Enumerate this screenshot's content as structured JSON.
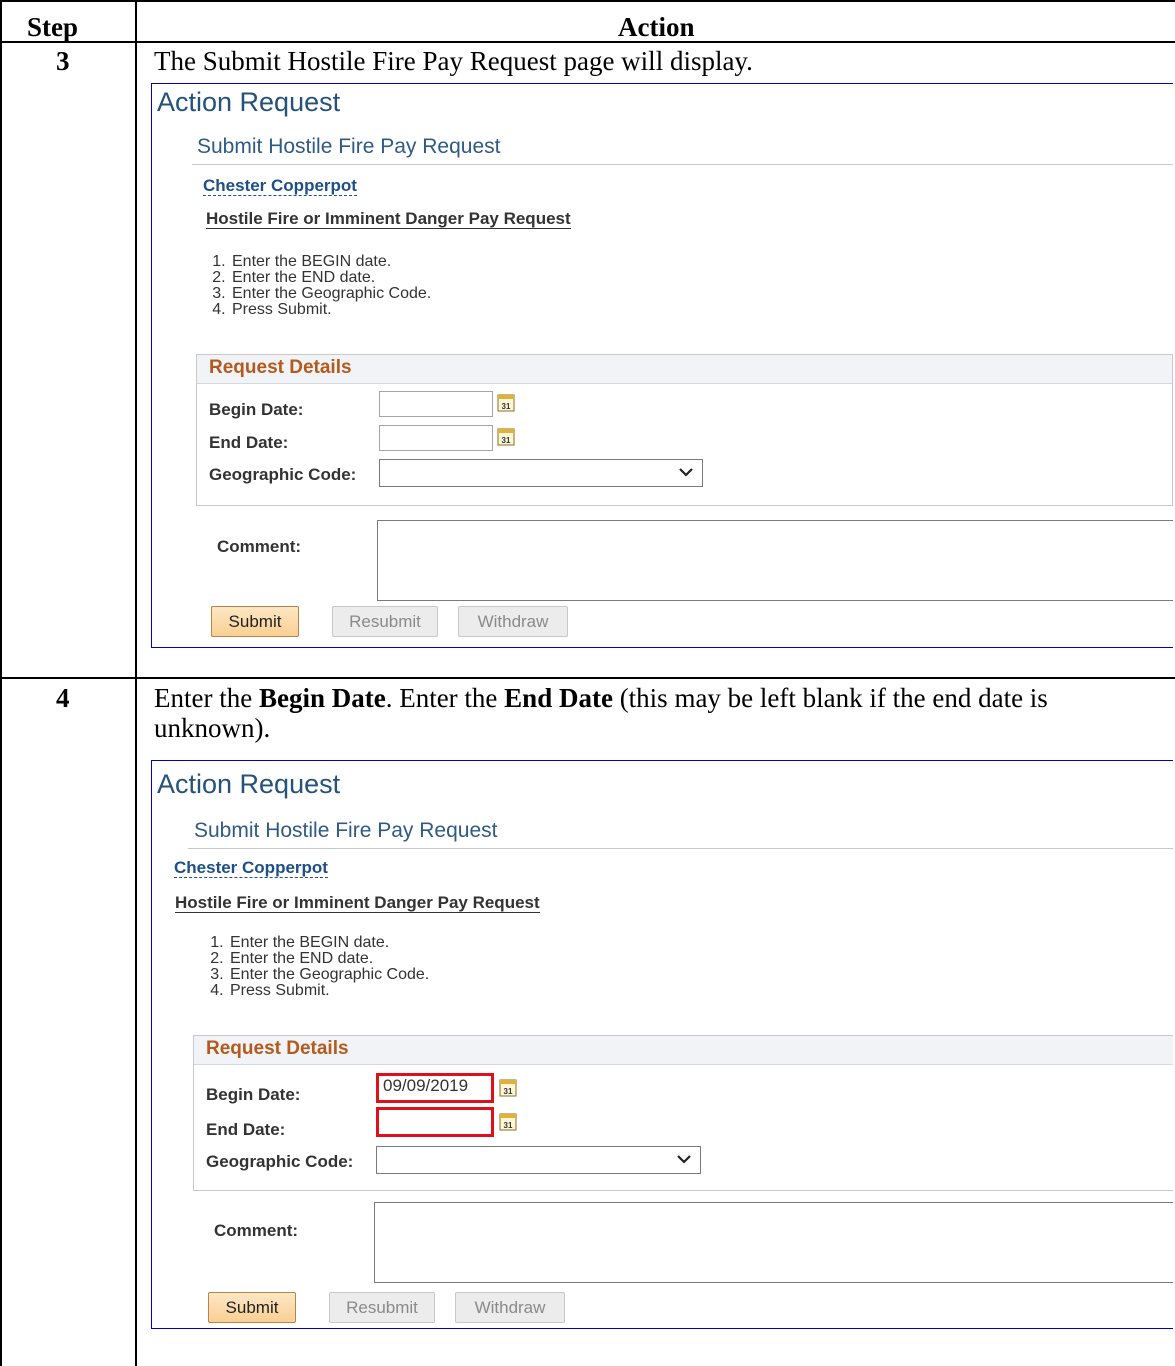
{
  "table": {
    "col_step": "Step",
    "col_action": "Action"
  },
  "steps": [
    {
      "number": "3",
      "instruction": "The Submit Hostile Fire Pay Request page will display.",
      "screen": {
        "title": "Action Request",
        "subtitle": "Submit Hostile Fire Pay Request",
        "person": "Chester Copperpot",
        "page_title": "Hostile Fire or Imminent Danger Pay Request",
        "list": [
          "Enter the BEGIN date.",
          "Enter the END date.",
          "Enter the Geographic Code.",
          "Press Submit."
        ],
        "section": "Request Details",
        "begin_label": "Begin Date:",
        "begin_value": "",
        "end_label": "End Date:",
        "end_value": "",
        "geo_label": "Geographic Code:",
        "comment_label": "Comment:",
        "submit": "Submit",
        "resubmit": "Resubmit",
        "withdraw": "Withdraw"
      }
    },
    {
      "number": "4",
      "instruction_parts": [
        "Enter the ",
        "Begin Date",
        ".  Enter the ",
        "End Date",
        " (this may be left blank if the end date is unknown)."
      ],
      "screen": {
        "title": "Action Request",
        "subtitle": "Submit Hostile Fire Pay Request",
        "person": "Chester Copperpot",
        "page_title": "Hostile Fire or Imminent Danger Pay Request",
        "list": [
          "Enter the BEGIN date.",
          "Enter the END date.",
          "Enter the Geographic Code.",
          "Press Submit."
        ],
        "section": "Request Details",
        "begin_label": "Begin Date:",
        "begin_value": "09/09/2019",
        "end_label": "End Date:",
        "end_value": "",
        "geo_label": "Geographic Code:",
        "comment_label": "Comment:",
        "submit": "Submit",
        "resubmit": "Resubmit",
        "withdraw": "Withdraw"
      }
    }
  ],
  "icons": {
    "calendar": "calendar-icon",
    "dropdown": "chevron-down-icon"
  },
  "colors": {
    "highlight": "#e0101a",
    "section_header": "#b45a1c",
    "title_blue": "#24527a"
  }
}
